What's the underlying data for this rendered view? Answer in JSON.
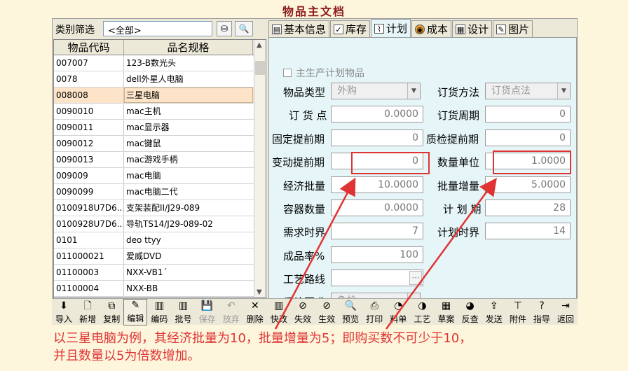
{
  "doc_title": "物品主文档",
  "filter": {
    "label": "类别筛选",
    "value": "<全部>"
  },
  "grid": {
    "headers": [
      "物品代码",
      "品名规格"
    ],
    "rows": [
      {
        "code": "007007",
        "name": "123-B数光头"
      },
      {
        "code": "0078",
        "name": "dell外星人电脑"
      },
      {
        "code": "008008",
        "name": "三星电脑"
      },
      {
        "code": "0090010",
        "name": "mac主机"
      },
      {
        "code": "0090011",
        "name": "mac显示器"
      },
      {
        "code": "0090012",
        "name": "mac键鼠"
      },
      {
        "code": "0090013",
        "name": "mac游戏手柄"
      },
      {
        "code": "009009",
        "name": "mac电脑"
      },
      {
        "code": "0090099",
        "name": "mac电脑二代"
      },
      {
        "code": "0100918U7D6...",
        "name": "支架装配II/J29-089"
      },
      {
        "code": "0100928U7D6...",
        "name": "导轨TS14/J29-089-02"
      },
      {
        "code": "0101",
        "name": "deo ttyy"
      },
      {
        "code": "011000021",
        "name": "爱威DVD"
      },
      {
        "code": "01100003",
        "name": "NXX-VB1´"
      },
      {
        "code": "01100004",
        "name": "NXX-BB"
      }
    ]
  },
  "tabs": [
    {
      "icon": "form-icon",
      "label": "基本信息"
    },
    {
      "icon": "stock-icon",
      "label": "库存"
    },
    {
      "icon": "chart-icon",
      "label": "计划"
    },
    {
      "icon": "cost-icon",
      "label": "成本"
    },
    {
      "icon": "design-icon",
      "label": "设计"
    },
    {
      "icon": "picture-icon",
      "label": "图片"
    }
  ],
  "plan": {
    "self_produce_label": "主生产计划物品",
    "item_type": {
      "label": "物品类型",
      "value": "外购"
    },
    "order_method": {
      "label": "订货方法",
      "value": "订货点法"
    },
    "reorder_point": {
      "label": "订 货 点",
      "value": "0.0000"
    },
    "order_cycle": {
      "label": "订货周期",
      "value": "0"
    },
    "fixed_lead": {
      "label": "固定提前期",
      "value": "0"
    },
    "qc_lead": {
      "label": "质检提前期",
      "value": "0"
    },
    "variable_lead": {
      "label": "变动提前期",
      "value": "0"
    },
    "unit_qty": {
      "label": "数量单位",
      "value": "1.0000"
    },
    "eco_batch": {
      "label": "经济批量",
      "value": "10.0000"
    },
    "batch_incr": {
      "label": "批量增量",
      "value": "5.0000"
    },
    "container_qty": {
      "label": "容器数量",
      "value": "0.0000"
    },
    "plan_period": {
      "label": "计 划 期",
      "value": "28"
    },
    "demand_fence": {
      "label": "需求时界",
      "value": "7"
    },
    "plan_fence": {
      "label": "计划时界",
      "value": "14"
    },
    "yield_rate": {
      "label": "成品率%",
      "value": "100"
    },
    "routing": {
      "label": "工艺路线",
      "value": ""
    },
    "qc_req": {
      "label": "质检要求",
      "value": "免检"
    }
  },
  "toolbar": [
    {
      "label": "导入",
      "icon": "import-icon"
    },
    {
      "label": "新增",
      "icon": "new-icon"
    },
    {
      "label": "复制",
      "icon": "copy-icon"
    },
    {
      "label": "编辑",
      "icon": "edit-icon"
    },
    {
      "label": "编码",
      "icon": "code-icon"
    },
    {
      "label": "批号",
      "icon": "batch-icon"
    },
    {
      "label": "保存",
      "icon": "save-icon"
    },
    {
      "label": "放弃",
      "icon": "undo-icon"
    },
    {
      "label": "删除",
      "icon": "delete-icon"
    },
    {
      "label": "快改",
      "icon": "quick-edit-icon"
    },
    {
      "label": "失效",
      "icon": "invalidate-icon"
    },
    {
      "label": "生效",
      "icon": "validate-icon"
    },
    {
      "label": "预览",
      "icon": "preview-icon"
    },
    {
      "label": "打印",
      "icon": "print-icon"
    },
    {
      "label": "料单",
      "icon": "bom-icon"
    },
    {
      "label": "工艺",
      "icon": "process-icon"
    },
    {
      "label": "草案",
      "icon": "draft-icon"
    },
    {
      "label": "反查",
      "icon": "reverse-icon"
    },
    {
      "label": "发送",
      "icon": "send-icon"
    },
    {
      "label": "附件",
      "icon": "attach-icon"
    },
    {
      "label": "指导",
      "icon": "help-icon"
    },
    {
      "label": "返回",
      "icon": "exit-icon"
    }
  ],
  "caption": {
    "line1": "以三星电脑为例，其经济批量为10，批量增量为5；即购买数不可少于10，",
    "line2": "并且数量以5为倍数增加。"
  },
  "colors": {
    "accent": "#e03434",
    "panel": "#e6f6f8",
    "selected_row": "#fde3c8"
  }
}
